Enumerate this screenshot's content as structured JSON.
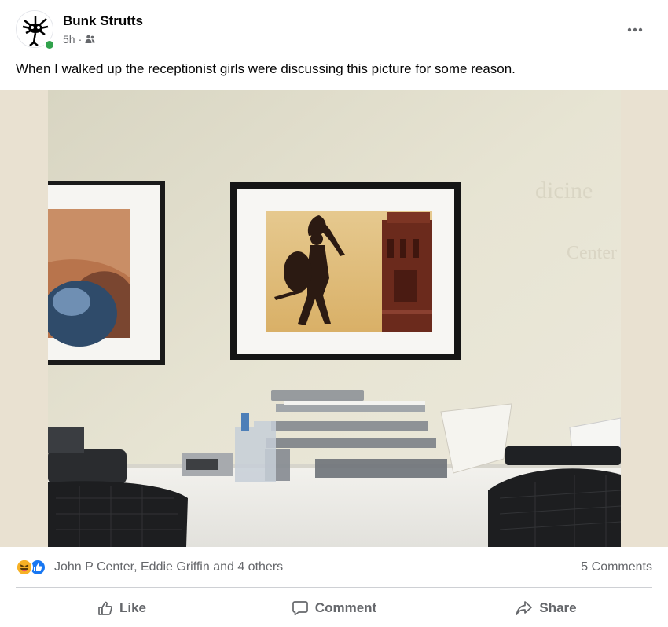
{
  "post": {
    "author": "Bunk Strutts",
    "timestamp": "5h",
    "separator": "·",
    "audience_icon": "friends-icon",
    "text": "When I walked up the receptionist girls were discussing this picture for some reason.",
    "online": true
  },
  "reactions": {
    "icons": [
      "haha-reaction-icon",
      "like-reaction-icon"
    ],
    "names": "John P Center, Eddie Griffin and 4 others",
    "comments": "5 Comments"
  },
  "actions": {
    "like": "Like",
    "comment": "Comment",
    "share": "Share"
  },
  "colors": {
    "accent": "#1877f2",
    "haha": "#f7b125",
    "online": "#31a24c",
    "secondary_text": "#65676b"
  }
}
